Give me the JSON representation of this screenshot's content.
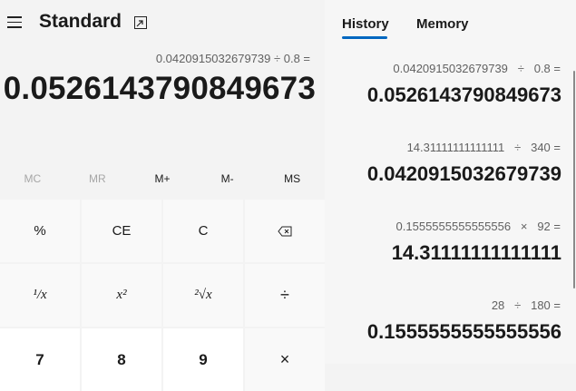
{
  "header": {
    "title": "Standard",
    "menu_icon": "hamburger-icon",
    "keep_on_top_icon": "keep-on-top-icon"
  },
  "display": {
    "expression": "0.0420915032679739 ÷ 0.8 =",
    "value": "0.0526143790849673"
  },
  "memory": {
    "mc": "MC",
    "mr": "MR",
    "mplus": "M+",
    "mminus": "M-",
    "ms": "MS"
  },
  "keys": {
    "percent": "%",
    "ce": "CE",
    "c": "C",
    "reciprocal": "¹/x",
    "square": "x²",
    "sqrt": "²√x",
    "divide": "÷",
    "seven": "7",
    "eight": "8",
    "nine": "9",
    "multiply": "×"
  },
  "tabs": {
    "history": "History",
    "memory": "Memory"
  },
  "history": [
    {
      "expression": "0.0420915032679739   ÷   0.8 =",
      "result": "0.0526143790849673"
    },
    {
      "expression": "14.31111111111111   ÷   340 =",
      "result": "0.0420915032679739"
    },
    {
      "expression": "0.1555555555555556   ×   92 =",
      "result": "14.31111111111111"
    },
    {
      "expression": "28   ÷   180 =",
      "result": "0.1555555555555556"
    }
  ],
  "colors": {
    "accent": "#0067c0",
    "background": "#f3f3f3",
    "digit_key": "#ffffff"
  }
}
